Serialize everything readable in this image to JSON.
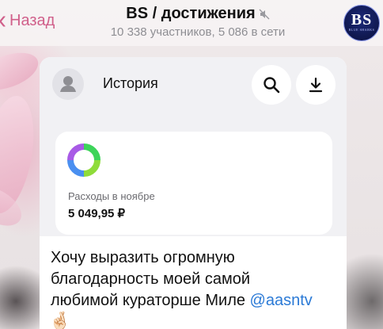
{
  "header": {
    "back_label": "Назад",
    "title": "BS / достижения",
    "subtitle": "10 338 участников, 5 086 в сети",
    "logo_text": "BS",
    "logo_subtext": "BLUE SHARKS"
  },
  "message": {
    "screenshot": {
      "title": "История",
      "card_label": "Расходы в ноябре",
      "card_value": "5 049,95 ₽"
    },
    "text_line1": "Хочу выразить огромную",
    "text_line2": "благодарность моей самой",
    "text_line3": "любимой кураторше Миле ",
    "mention": "@aasntv",
    "emoji": "🤞🏻"
  },
  "colors": {
    "accent": "#d05f8a",
    "mention": "#2b7ad6"
  },
  "icons": [
    "back-chevron-icon",
    "mute-icon",
    "profile-icon",
    "search-icon",
    "download-icon",
    "chart-ring-icon"
  ]
}
